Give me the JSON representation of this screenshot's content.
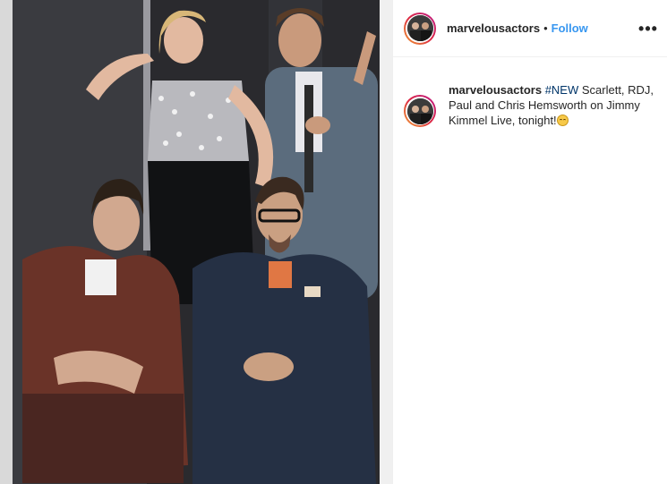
{
  "post": {
    "username": "marvelousactors",
    "separator": "•",
    "follow_label": "Follow",
    "more_icon": "more-horizontal-icon"
  },
  "caption": {
    "username": "marvelousactors",
    "hashtag": "#NEW",
    "text": " Scarlett, RDJ, Paul and Chris Hemsworth on Jimmy Kimmel Live, tonight!",
    "emoji": "grinning-face-emoji"
  },
  "colors": {
    "link": "#3897f0",
    "hashtag": "#003569",
    "border": "#efefef",
    "text": "#262626"
  }
}
